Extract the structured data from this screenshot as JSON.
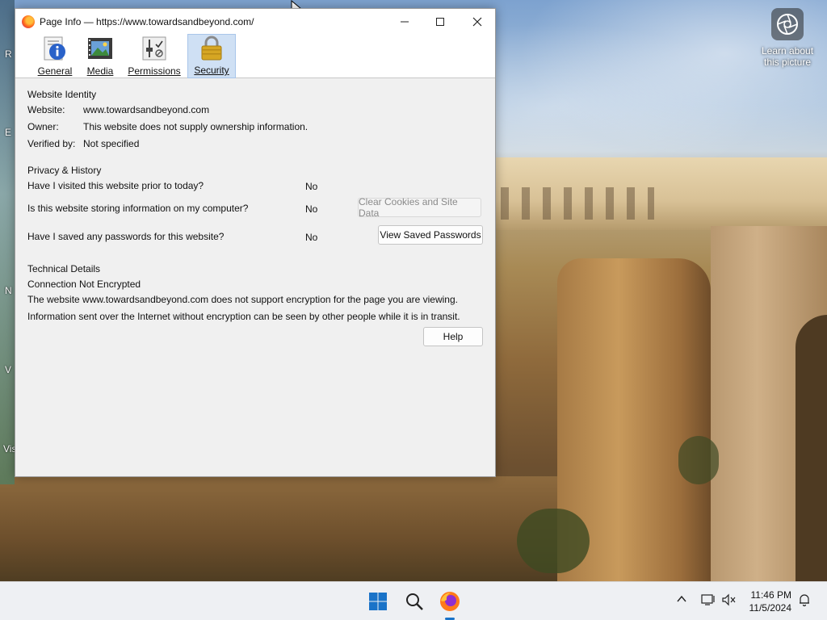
{
  "window": {
    "title": "Page Info — https://www.towardsandbeyond.com/",
    "controls": {
      "minimize": "—",
      "maximize": "☐",
      "close": "✕"
    }
  },
  "toolbar": {
    "tabs": [
      {
        "label": "General",
        "icon": "info-icon"
      },
      {
        "label": "Media",
        "icon": "media-icon"
      },
      {
        "label": "Permissions",
        "icon": "permissions-icon"
      },
      {
        "label": "Security",
        "icon": "padlock-icon",
        "active": true
      }
    ]
  },
  "identity": {
    "heading": "Website Identity",
    "website_label": "Website:",
    "website_value": "www.towardsandbeyond.com",
    "owner_label": "Owner:",
    "owner_value": "This website does not supply ownership information.",
    "verified_label": "Verified by:",
    "verified_value": "Not specified"
  },
  "privacy": {
    "heading": "Privacy & History",
    "visited_q": "Have I visited this website prior to today?",
    "visited_a": "No",
    "storing_q": "Is this website storing information on my computer?",
    "storing_a": "No",
    "clear_button": "Clear Cookies and Site Data",
    "passwords_q": "Have I saved any passwords for this website?",
    "passwords_a": "No",
    "view_passwords_button": "View Saved Passwords"
  },
  "technical": {
    "heading": "Technical Details",
    "status": "Connection Not Encrypted",
    "line1": "The website www.towardsandbeyond.com does not support encryption for the page you are viewing.",
    "line2": "Information sent over the Internet without encryption can be seen by other people while it is in transit.",
    "help_button": "Help"
  },
  "desktop": {
    "learn_label": "Learn about this picture",
    "edge_letters": [
      "R",
      "E",
      "N",
      "V",
      "Vis"
    ]
  },
  "taskbar": {
    "time": "11:46 PM",
    "date": "11/5/2024",
    "icons": [
      "windows-start-icon",
      "search-icon",
      "firefox-icon"
    ],
    "tray_icons": [
      "chevron-up-icon",
      "network-icon",
      "volume-muted-icon",
      "notification-bell-icon"
    ]
  },
  "colors": {
    "active_tab_bg": "#cfe0f4",
    "taskbar_bg": "#eef0f3",
    "window_bg": "#f0f0f0",
    "windows_blue": "#1a73c8"
  }
}
